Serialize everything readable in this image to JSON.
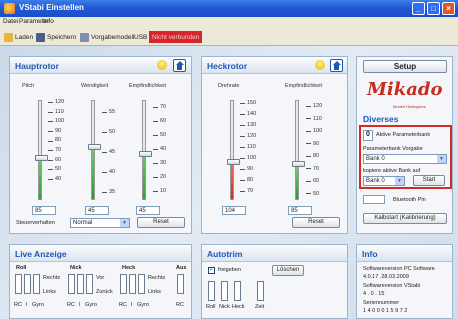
{
  "window": {
    "title": "VStabi Einstellen"
  },
  "menu": [
    "Datei",
    "Parameter",
    "Info"
  ],
  "toolbar": {
    "load": "Laden",
    "save": "Speichern",
    "default_model": "Vorgabemodell",
    "usb": "USB",
    "status": "Nicht verbunden"
  },
  "hauptrotor": {
    "title": "Hauptrotor",
    "columns": [
      "Pitch",
      "Wendigkeit",
      "Empfindlichkeit"
    ],
    "scales": [
      [
        "120",
        "110",
        "100",
        "90",
        "80",
        "70",
        "60",
        "50",
        "40"
      ],
      [
        "55",
        "50",
        "45",
        "40",
        "35"
      ],
      [
        "70",
        "60",
        "50",
        "40",
        "30",
        "20",
        "10"
      ]
    ],
    "values": [
      "85",
      "45",
      "45"
    ],
    "steuerverhalten_label": "Steuerverhalten",
    "steuerverhalten_value": "Normal",
    "reset": "Reset"
  },
  "heckrotor": {
    "title": "Heckrotor",
    "columns": [
      "Drehrate",
      "Empfindlichkeit"
    ],
    "scales": [
      [
        "150",
        "140",
        "130",
        "120",
        "110",
        "100",
        "90",
        "80",
        "70"
      ],
      [
        "120",
        "110",
        "100",
        "90",
        "80",
        "70",
        "60",
        "50"
      ]
    ],
    "values": [
      "104",
      "85"
    ],
    "reset": "Reset"
  },
  "side": {
    "setup": "Setup",
    "logo": "Mikado",
    "logo_sub": "Modell Helikopters",
    "diverses": "Diverses",
    "active_set_value": "0",
    "active_set_label": "Aktive Parameterbank",
    "preset_label": "Parameterbank Vorgabe",
    "preset_value": "Bank 0",
    "copy_label": "kopiere aktive Bank auf",
    "copy_value": "Bank 0",
    "start": "Start",
    "bluetooth": "Bluetooth Pin",
    "calibration": "Kalbstart (Kalibrierung)"
  },
  "live": {
    "title": "Live Anzeige",
    "groups": [
      "Roll",
      "Nick",
      "Heck",
      "Aux"
    ],
    "labels": [
      "Rechts",
      "Links",
      "Vor",
      "Zurück",
      "Rechts",
      "Links"
    ],
    "bottom": [
      "RC",
      "I",
      "Gyro",
      "RC",
      "I",
      "Gyro",
      "RC",
      "I",
      "Gyro",
      "RC"
    ]
  },
  "autotrim": {
    "title": "Autotrim",
    "freigeben": "freigeben",
    "loeschen": "Löschen",
    "bottom": [
      "Roll",
      "Nick",
      "Heck",
      "Zeit"
    ]
  },
  "info": {
    "title": "Info",
    "lines": [
      "Softwareversion PC Software",
      "4.0.17 .28.03.2009",
      "Softwareversion VStabi",
      "4 . 0 . 15",
      "Seriennummer",
      "1 4 0 0 0 1 5 9 7 2"
    ]
  },
  "colors": {
    "accent": "#1f57b6",
    "alert": "#d62a25",
    "fill": "#2e9b2a"
  }
}
